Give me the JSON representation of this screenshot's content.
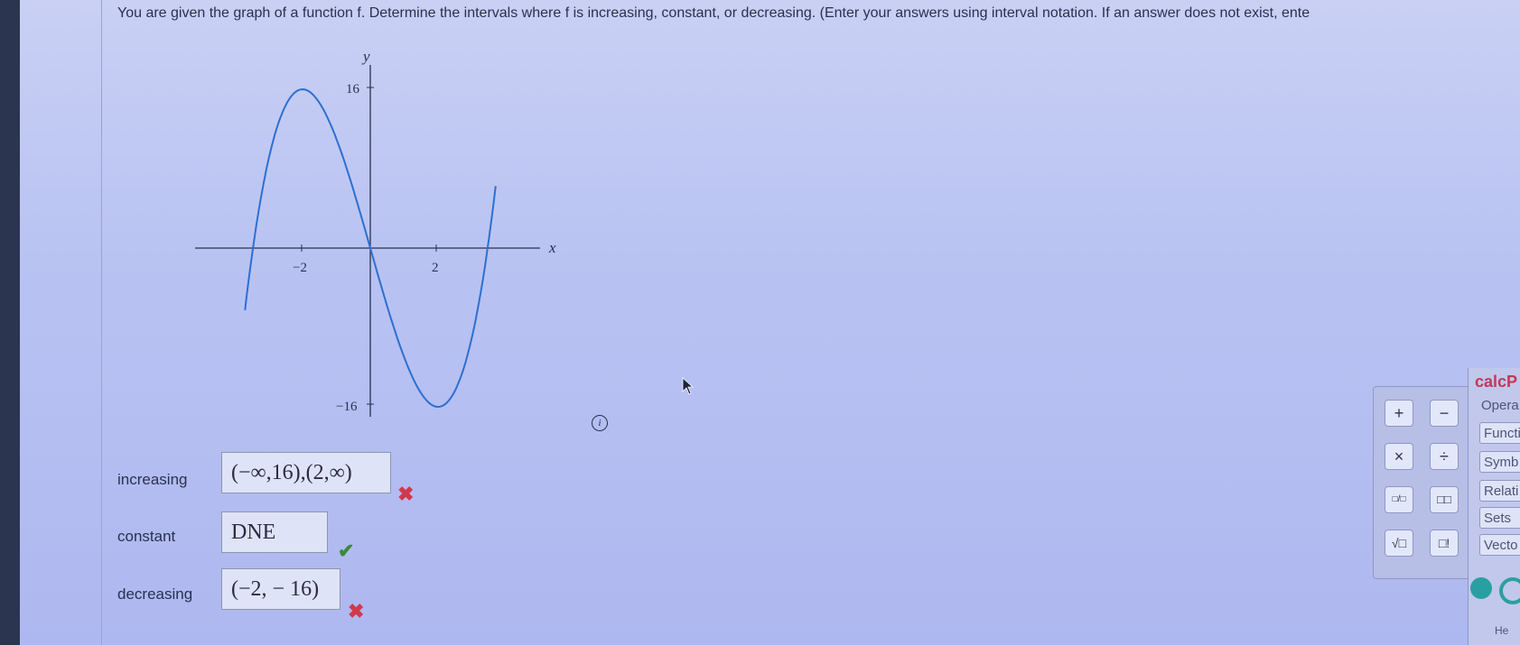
{
  "question": "You are given the graph of a function f. Determine the intervals where f is increasing, constant, or decreasing. (Enter your answers using interval notation. If an answer does not exist, ente",
  "graph": {
    "axis_x": "x",
    "axis_y": "y",
    "tick_x_neg": "−2",
    "tick_x_pos": "2",
    "tick_y_pos": "16",
    "tick_y_neg": "−16"
  },
  "answers": [
    {
      "label": "increasing",
      "value": "(−∞,16),(2,∞)",
      "status": "wrong",
      "mark": "✖"
    },
    {
      "label": "constant",
      "value": "DNE",
      "status": "correct",
      "mark": "✔"
    },
    {
      "label": "decreasing",
      "value": "(−2, − 16)",
      "status": "wrong",
      "mark": "✖"
    }
  ],
  "info_icon": "i",
  "keypad": {
    "keys": [
      "+",
      "−",
      "×",
      "÷",
      "□/□",
      "□□",
      "√□",
      "□!"
    ]
  },
  "side_panel": {
    "title": "calcP",
    "ops_label": "Opera",
    "tabs": [
      "Functi",
      "Symb",
      "Relati",
      "Sets",
      "Vecto"
    ],
    "help": "He"
  },
  "colors": {
    "curve": "#2e6fd0",
    "wrong": "#d03a4a",
    "correct": "#3a8a3a"
  }
}
